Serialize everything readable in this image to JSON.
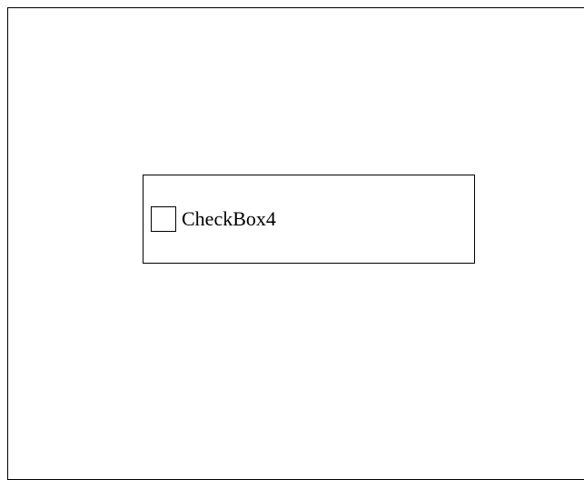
{
  "checkbox": {
    "label": "CheckBox4",
    "checked": false
  }
}
